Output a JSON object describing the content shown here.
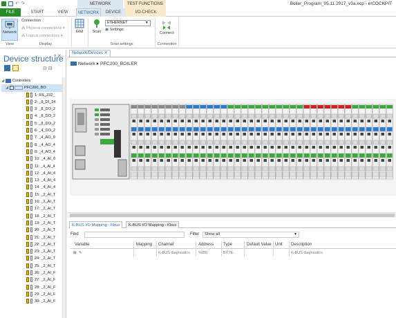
{
  "window": {
    "title": "Boiler_Program_05.11.2017_v3a.ecp - e!COCKPIT",
    "context_tabs": {
      "network_functions": "NETWORK FUNCTIONS",
      "test_functions": "TEST FUNCTIONS"
    }
  },
  "ribbon_tabs": [
    {
      "label": "FILE"
    },
    {
      "label": "START"
    },
    {
      "label": "VIEW"
    },
    {
      "label": "NETWORK"
    },
    {
      "label": "DEVICE"
    },
    {
      "label": "I/O-CHECK"
    }
  ],
  "ribbon": {
    "network_button": "Network",
    "connection_label": "Connection",
    "physical_connections": "Physical connections",
    "logical_connections": "Logical connections",
    "grid_button": "Grid",
    "scan_button": "Scan",
    "scan_combo_value": "ETHERNET",
    "settings_button": "Settings",
    "connect_button": "Connect",
    "groups": {
      "view": "View",
      "display": "Display",
      "scan_settings": "Scan settings",
      "connection": "Connection"
    }
  },
  "left_panel": {
    "title": "Device structure",
    "controllers_label": "Controllers",
    "controller": "PFC200_BO",
    "modules": [
      "1: RS_232_",
      "2: _8_DI_24",
      "3: _8_DO_2",
      "4: _8_DO_2",
      "5: _8_DO_2",
      "6: _4_DO_2",
      "7: _4_AO_0",
      "8: _4_AO_4",
      "9: _4_AO_4",
      "10: _4_AI_0",
      "11: _4_AI_4",
      "12: _4_AI_4",
      "13: _4_AI_4",
      "14: _4_AI_4",
      "15: _2_AI_T",
      "16: _2_AI_T",
      "17: _2_AI_T",
      "18: _2_AI_T",
      "19: _2_AI_T",
      "20: _2_AI_T",
      "21: _2_AI_T",
      "22: _2_AI_T",
      "23: _2_AI_T",
      "24: _2_AI_T",
      "25: _2_AI_T",
      "26: _2_AI_F",
      "27: _2_AI_F",
      "28: _2_AI_F",
      "29: _2_AI_F",
      "30: _2_AI_F"
    ]
  },
  "document": {
    "tab_label": "Network/Devices",
    "breadcrumb_root": "Network",
    "breadcrumb_device": "PFC200_BOILER"
  },
  "bottom_panel": {
    "tabs": [
      "K-BUS I/O Mapping - Kbus",
      "K-BUS I/O Mapping - Kbus"
    ],
    "find_label": "Find",
    "filter_label": "Filter",
    "filter_value": "Show all",
    "columns": [
      "Variable",
      "Mapping",
      "Channel",
      "Address",
      "Type",
      "Default Value",
      "Unit",
      "Description"
    ],
    "rows": [
      {
        "variable": "",
        "mapping": "",
        "channel": "K-BUS diagnostics",
        "address": "%IB0",
        "type": "BYTE",
        "default": "",
        "unit": "",
        "description": "K-BUS diagnostics"
      }
    ]
  },
  "colors": {
    "file_tab": "#2a8a2a",
    "accent_blue": "#2a6ab0",
    "module_yellow": "#e2b000",
    "stripe_red": "#d42020",
    "stripe_blue": "#2a7bd6",
    "stripe_yellow": "#f0d000",
    "stripe_green": "#3aaa3a"
  }
}
